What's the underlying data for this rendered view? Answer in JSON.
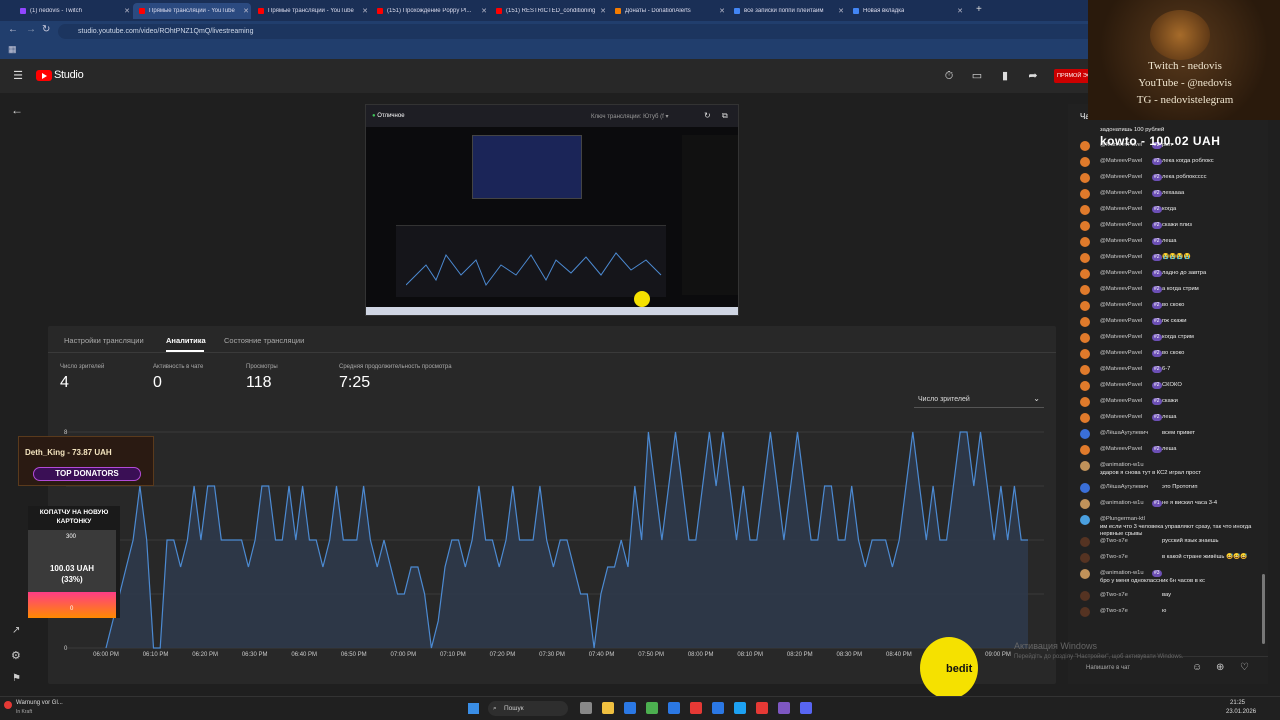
{
  "browser": {
    "tabs": [
      {
        "label": "(1) nedovis - Twitch",
        "color": "#9146ff",
        "active": false
      },
      {
        "label": "Прямые трансляции - YouTube",
        "color": "#ff0000",
        "active": true
      },
      {
        "label": "Прямые трансляции - YouTube",
        "color": "#ff0000",
        "active": false
      },
      {
        "label": "(151) Прохождение Poppy Pl...",
        "color": "#ff0000",
        "active": false
      },
      {
        "label": "(151) RESTRICTED_conditioning",
        "color": "#ff0000",
        "active": false
      },
      {
        "label": "Донаты - DonationAlerts",
        "color": "#f57c00",
        "active": false
      },
      {
        "label": "все записки поппи плейтайм",
        "color": "#4285f4",
        "active": false
      },
      {
        "label": "Новая вкладка",
        "color": "#4285f4",
        "active": false
      }
    ],
    "url": "studio.youtube.com/video/ROhtPNZ1QmQ/livestreaming"
  },
  "header": {
    "logo_text": "Studio",
    "live_button": "ПРЯМОЙ ЭФИР"
  },
  "panel": {
    "tabs": [
      "Настройки трансляции",
      "Аналитика",
      "Состояние трансляции"
    ],
    "active_tab": 1,
    "metrics": [
      {
        "label": "Число зрителей",
        "value": "4"
      },
      {
        "label": "Активность в чате",
        "value": "0"
      },
      {
        "label": "Просмотры",
        "value": "118"
      },
      {
        "label": "Средняя продолжительность просмотра",
        "value": "7:25"
      }
    ],
    "dropdown_label": "Число зрителей"
  },
  "chart_data": {
    "type": "area",
    "title": "",
    "xlabel": "",
    "ylabel": "",
    "ylim": [
      0,
      8
    ],
    "y_ticks": [
      0,
      8
    ],
    "x_ticks": [
      "06:00 PM",
      "06:10 PM",
      "06:20 PM",
      "06:30 PM",
      "06:40 PM",
      "06:50 PM",
      "07:00 PM",
      "07:10 PM",
      "07:20 PM",
      "07:30 PM",
      "07:40 PM",
      "07:50 PM",
      "08:00 PM",
      "08:10 PM",
      "08:20 PM",
      "08:30 PM",
      "08:40 PM",
      "08:50 PM",
      "09:00 PM"
    ],
    "series": [
      {
        "values": [
          0,
          1,
          2,
          3,
          4,
          6,
          4,
          0,
          0,
          4,
          4,
          3,
          4,
          6,
          4,
          6,
          6,
          4,
          4,
          4,
          4,
          3,
          4,
          6,
          6,
          4,
          4,
          6,
          4,
          6,
          4,
          4,
          3,
          4,
          6,
          4,
          4,
          4,
          6,
          4,
          3,
          4,
          3,
          2,
          2,
          3,
          3,
          2,
          0,
          1,
          3,
          4,
          4,
          3,
          4,
          6,
          4,
          4,
          3,
          4,
          6,
          4,
          4,
          4,
          6,
          4,
          3,
          4,
          4,
          3,
          2,
          2,
          0,
          2,
          3,
          3,
          4,
          3,
          6,
          4,
          8,
          6,
          4,
          6,
          8,
          6,
          4,
          4,
          6,
          8,
          6,
          8,
          6,
          4,
          6,
          4,
          4,
          6,
          8,
          6,
          4,
          6,
          8,
          6,
          4,
          4,
          6,
          6,
          4,
          4,
          6,
          4,
          3,
          4,
          4,
          4,
          3,
          4,
          6,
          8,
          6,
          4,
          6,
          4,
          4,
          6,
          8,
          8,
          6,
          8,
          6,
          4,
          6,
          4,
          6,
          4,
          4
        ]
      }
    ],
    "grid": true
  },
  "chat": {
    "header": "Чат",
    "top_text": "задонатишь 100 рублей",
    "messages": [
      {
        "name": "@MatveevPavel",
        "badge": "#2",
        "text": "рил"
      },
      {
        "name": "@MatveevPavel",
        "badge": "#2",
        "text": "лека когда роблокс"
      },
      {
        "name": "@MatveevPavel",
        "badge": "#2",
        "text": "лека роблоксссс"
      },
      {
        "name": "@MatveevPavel",
        "badge": "#2",
        "text": "лехаааа"
      },
      {
        "name": "@MatveevPavel",
        "badge": "#2",
        "text": "когда"
      },
      {
        "name": "@MatveevPavel",
        "badge": "#2",
        "text": "скажи плиз"
      },
      {
        "name": "@MatveevPavel",
        "badge": "#2",
        "text": "леша"
      },
      {
        "name": "@MatveevPavel",
        "badge": "#2",
        "text": "😭😭😭😭"
      },
      {
        "name": "@MatveevPavel",
        "badge": "#2",
        "text": "ладно до завтра"
      },
      {
        "name": "@MatveevPavel",
        "badge": "#2",
        "text": "а когда стрим"
      },
      {
        "name": "@MatveevPavel",
        "badge": "#2",
        "text": "во скоко"
      },
      {
        "name": "@MatveevPavel",
        "badge": "#2",
        "text": "пж скажи"
      },
      {
        "name": "@MatveevPavel",
        "badge": "#2",
        "text": "когда стрим"
      },
      {
        "name": "@MatveevPavel",
        "badge": "#2",
        "text": "во скоко"
      },
      {
        "name": "@MatveevPavel",
        "badge": "#2",
        "text": "6-7"
      },
      {
        "name": "@MatveevPavel",
        "badge": "#2",
        "text": "СКОКО"
      },
      {
        "name": "@MatveevPavel",
        "badge": "#2",
        "text": "скажи"
      },
      {
        "name": "@MatveevPavel",
        "badge": "#2",
        "text": "леша"
      },
      {
        "name": "@ЛёшаАугулевич",
        "badge": "",
        "text": "всем привет"
      },
      {
        "name": "@MatveevPavel",
        "badge": "#2",
        "text": "леша"
      },
      {
        "name": "@animation-w1u",
        "badge": "",
        "text": "здаров я снова тут в КС2 играл прост"
      },
      {
        "name": "@ЛёшаАугулевич",
        "badge": "",
        "text": "это Прототип"
      },
      {
        "name": "@animation-w1u",
        "badge": "#1",
        "text": "не я вискил часа 3-4"
      },
      {
        "name": "@Plungerman-ktl",
        "badge": "",
        "text": "им если что 3 человека управляют сразу, так что иногда нервные срывы"
      },
      {
        "name": "@Two-s7e",
        "badge": "",
        "text": "русский язык знаешь"
      },
      {
        "name": "@Two-s7e",
        "badge": "",
        "text": "в какой стране живёшь 😅😅😅"
      },
      {
        "name": "@animation-w1u",
        "badge": "#3",
        "text": "бро у меня одноклассник 6н часов в кс"
      },
      {
        "name": "@Two-s7e",
        "badge": "",
        "text": "вау"
      },
      {
        "name": "@Two-s7e",
        "badge": "",
        "text": "ю"
      }
    ],
    "input_placeholder": "Напишите в чат"
  },
  "overlay": {
    "lines": [
      "Twitch - nedovis",
      "YouTube - @nedovis",
      "TG - nedovistelegram"
    ],
    "donation_banner": "kowto - 100.02 UAH",
    "top_donator": "Deth_King - 73.87 UAH",
    "top_donators_label": "TOP DONATORS",
    "goal_title": "КОПАТЧУ НА НОВУЮ КАРТОНКУ",
    "goal_max": "300",
    "goal_amount": "100.03 UAH",
    "goal_percent": "(33%)",
    "goal_min": "0",
    "goal_fraction": 0.33,
    "watermark_brand": "bedit"
  },
  "windows": {
    "activation_title": "Активация Windows",
    "activation_sub": "Перейдіть до розділу \"Настройки\", щоб активувати Windows.",
    "search_label": "Пошук",
    "warning_title": "Warnung vor Gl...",
    "warning_sub": "In Kraft",
    "time": "21:25",
    "date": "23.01.2026"
  }
}
